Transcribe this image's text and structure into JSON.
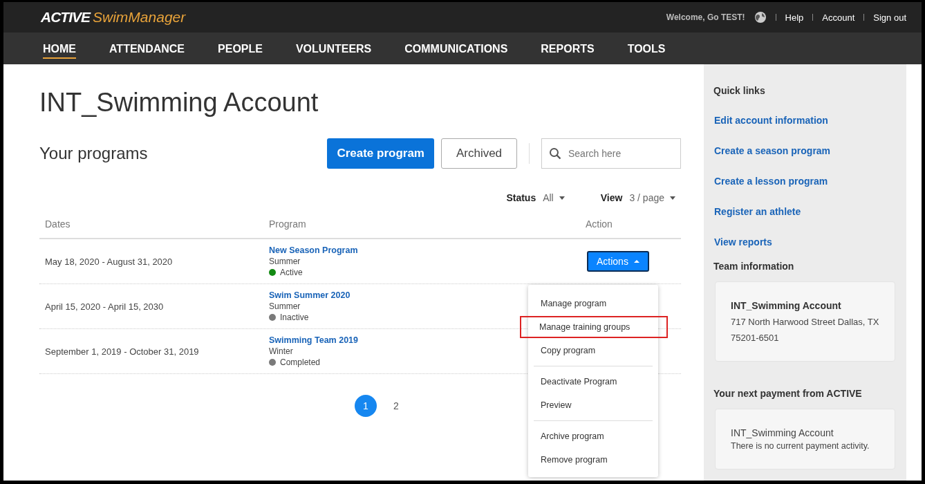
{
  "header": {
    "logo": {
      "brand": "ACTIVE",
      "product": "SwimManager"
    },
    "welcome": "Welcome, Go TEST!",
    "links": [
      "Help",
      "Account",
      "Sign out"
    ]
  },
  "nav": [
    {
      "label": "HOME",
      "selected": true
    },
    {
      "label": "ATTENDANCE",
      "selected": false
    },
    {
      "label": "PEOPLE",
      "selected": false
    },
    {
      "label": "VOLUNTEERS",
      "selected": false
    },
    {
      "label": "COMMUNICATIONS",
      "selected": false
    },
    {
      "label": "REPORTS",
      "selected": false
    },
    {
      "label": "TOOLS",
      "selected": false
    }
  ],
  "page_title": "INT_Swimming Account",
  "programs": {
    "heading": "Your programs",
    "create_button": "Create program",
    "archived_button": "Archived",
    "search": {
      "placeholder": "Search here"
    },
    "status_filter": {
      "label": "Status",
      "value": "All"
    },
    "view_filter": {
      "label": "View",
      "value": "3 / page"
    },
    "columns": [
      "Dates",
      "Program",
      "Action"
    ],
    "rows": [
      {
        "dates": "May 18, 2020 - August 31, 2020",
        "name": "New Season Program",
        "season": "Summer",
        "status": "Active",
        "color": "#138a13",
        "action": "Actions"
      },
      {
        "dates": "April 15, 2020 - April 15, 2030",
        "name": "Swim Summer 2020",
        "season": "Summer",
        "status": "Inactive",
        "color": "#7a7a7a"
      },
      {
        "dates": "September 1, 2019 - October 31, 2019",
        "name": "Swimming Team 2019",
        "season": "Winter",
        "status": "Completed",
        "color": "#7a7a7a"
      }
    ],
    "pages": [
      {
        "label": "1",
        "selected": true
      },
      {
        "label": "2",
        "selected": false
      }
    ],
    "action_menu": [
      [
        {
          "label": "Manage program",
          "highlighted": false
        },
        {
          "label": "Manage training groups",
          "highlighted": true
        },
        {
          "label": "Copy program",
          "highlighted": false
        }
      ],
      [
        {
          "label": "Deactivate Program",
          "highlighted": false
        },
        {
          "label": "Preview",
          "highlighted": false
        }
      ],
      [
        {
          "label": "Archive program",
          "highlighted": false
        },
        {
          "label": "Remove program",
          "highlighted": false
        }
      ]
    ]
  },
  "sidebar": {
    "quick_links_title": "Quick links",
    "quick_links": [
      "Edit account information",
      "Create a season program",
      "Create a lesson program",
      "Register an athlete",
      "View reports"
    ],
    "team_title": "Team information",
    "team": {
      "name": "INT_Swimming Account",
      "address": "717 North Harwood Street Dallas, TX",
      "zip": "75201-6501"
    },
    "payment_title": "Your next payment from ACTIVE",
    "payment": {
      "name": "INT_Swimming Account",
      "note": "There is no current payment activity."
    }
  }
}
